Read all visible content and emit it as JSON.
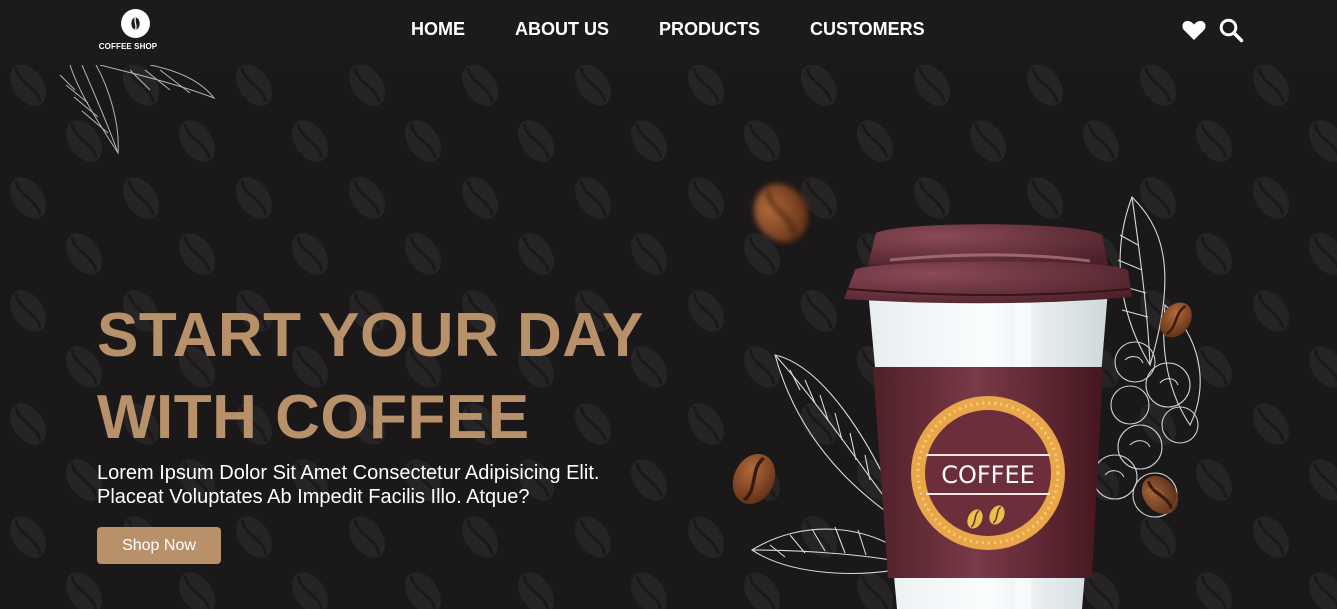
{
  "header": {
    "logo_text": "COFFEE SHOP",
    "nav": {
      "home": "HOME",
      "about": "ABOUT US",
      "products": "PRODUCTS",
      "customers": "CUSTOMERS"
    },
    "icons": [
      "heart-icon",
      "search-icon"
    ]
  },
  "hero": {
    "title_line1": "START YOUR DAY",
    "title_line2": "WITH COFFEE",
    "subtitle_line1": "Lorem Ipsum Dolor Sit Amet Consectetur Adipisicing Elit.",
    "subtitle_line2": "Placeat Voluptates Ab Impedit Facilis Illo. Atque?",
    "cta_label": "Shop Now",
    "cup_label": "COFFEE"
  },
  "colors": {
    "background": "#1a1818",
    "header": "#1c1b1b",
    "accent": "#b8916a",
    "cup": "#6b2e3a",
    "text": "#ffffff"
  }
}
